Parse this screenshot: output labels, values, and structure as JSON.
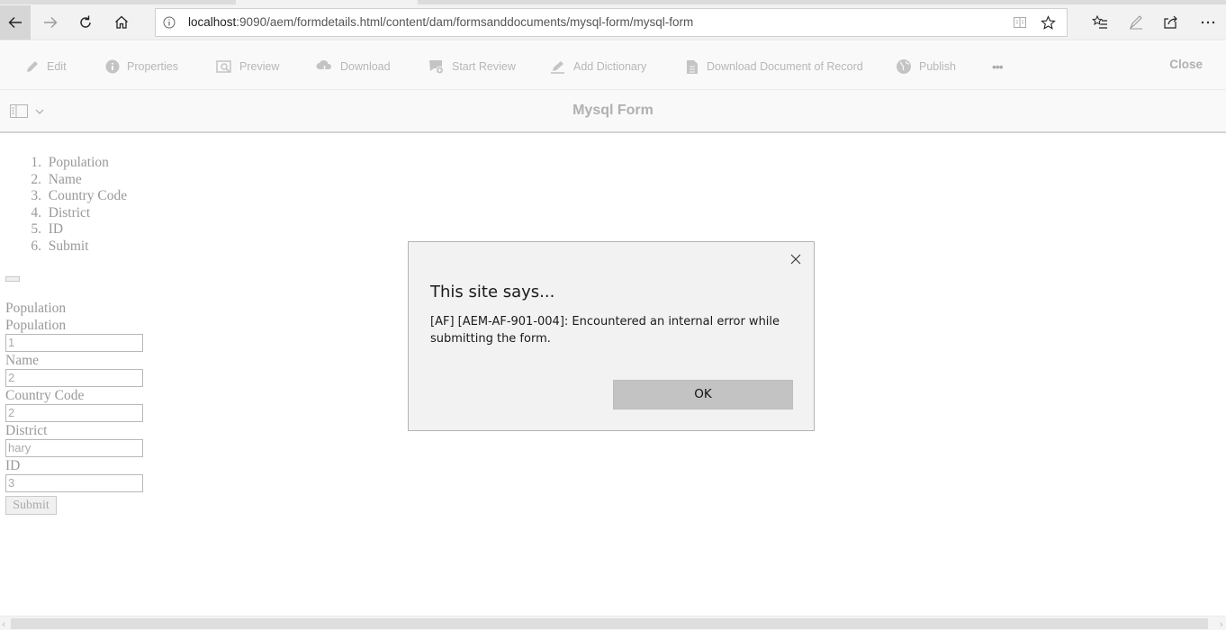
{
  "browser": {
    "url_host": "localhost",
    "url_rest": ":9090/aem/formdetails.html/content/dam/formsanddocuments/mysql-form/mysql-form"
  },
  "toolbar": {
    "items": [
      {
        "label": "Edit",
        "icon": "pencil-icon"
      },
      {
        "label": "Properties",
        "icon": "info-icon"
      },
      {
        "label": "Preview",
        "icon": "preview-icon"
      },
      {
        "label": "Download",
        "icon": "cloud-download-icon"
      },
      {
        "label": "Start Review",
        "icon": "review-icon"
      },
      {
        "label": "Add Dictionary",
        "icon": "dictionary-icon"
      },
      {
        "label": "Download Document of Record",
        "icon": "document-icon"
      },
      {
        "label": "Publish",
        "icon": "globe-icon"
      }
    ],
    "more": "•••",
    "close": "Close"
  },
  "titlebar": {
    "title": "Mysql Form"
  },
  "form": {
    "steps": [
      {
        "num": "1.",
        "label": "Population"
      },
      {
        "num": "2.",
        "label": "Name"
      },
      {
        "num": "3.",
        "label": "Country Code"
      },
      {
        "num": "4.",
        "label": "District"
      },
      {
        "num": "5.",
        "label": "ID"
      },
      {
        "num": "6.",
        "label": "Submit"
      }
    ],
    "section_title": "Population",
    "fields": [
      {
        "label": "Population",
        "value": "1"
      },
      {
        "label": "Name",
        "value": "2"
      },
      {
        "label": "Country Code",
        "value": "2"
      },
      {
        "label": "District",
        "value": "hary"
      },
      {
        "label": "ID",
        "value": "3"
      }
    ],
    "submit_label": "Submit"
  },
  "dialog": {
    "heading": "This site says...",
    "message": " [AF]  [AEM-AF-901-004]: Encountered an internal error while submitting the form.",
    "ok_label": "OK"
  },
  "colors": {
    "chrome_bg": "#f2f2f2",
    "toolbar_text": "#b7b7b7",
    "dialog_bg": "#f2f2f2",
    "ok_button": "#c3c3c3"
  }
}
